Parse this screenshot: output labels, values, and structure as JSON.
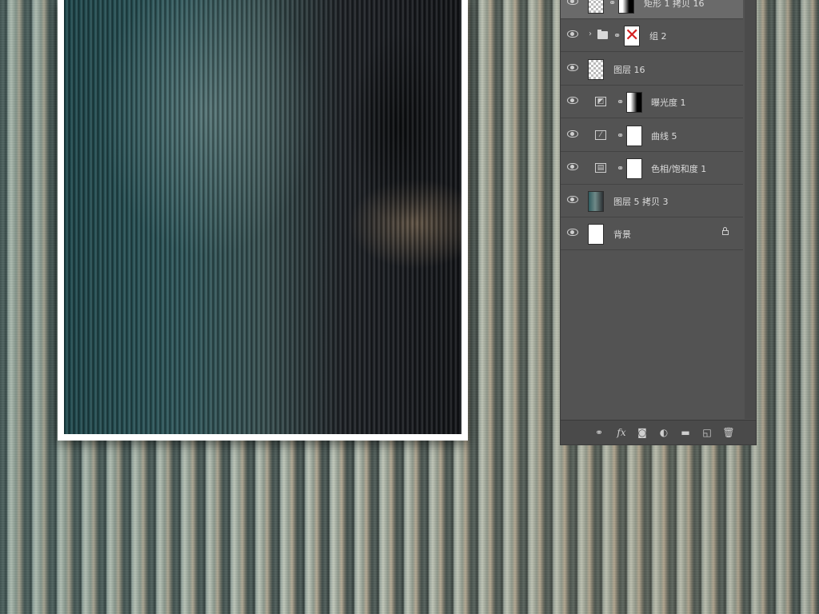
{
  "layers": [
    {
      "name": "矩形 1 拷贝 16",
      "thumb": "checker",
      "mask": "gradient",
      "linked": true,
      "selected": true
    },
    {
      "name": "组 2",
      "type": "group",
      "mask": "red-x",
      "linked": true
    },
    {
      "name": "图层 16",
      "thumb": "checker"
    },
    {
      "name": "曝光度 1",
      "type": "adjustment",
      "icon": "exposure-icon",
      "mask": "gradient",
      "linked": true
    },
    {
      "name": "曲线 5",
      "type": "adjustment",
      "icon": "curves-icon",
      "mask": "white",
      "linked": true
    },
    {
      "name": "色相/饱和度 1",
      "type": "adjustment",
      "icon": "hue-saturation-icon",
      "mask": "white",
      "linked": true
    },
    {
      "name": "图层 5 拷贝 3",
      "thumb": "photo"
    },
    {
      "name": "背景",
      "thumb": "white",
      "locked": true
    }
  ],
  "footer_icons": [
    "link-layers-icon",
    "fx-icon",
    "add-mask-icon",
    "adjustment-layer-icon",
    "new-group-icon",
    "new-layer-icon",
    "delete-icon"
  ],
  "colors": {
    "panel_bg": "#535353",
    "selected_row": "#6a6a6a",
    "text": "#dcdcdc"
  }
}
